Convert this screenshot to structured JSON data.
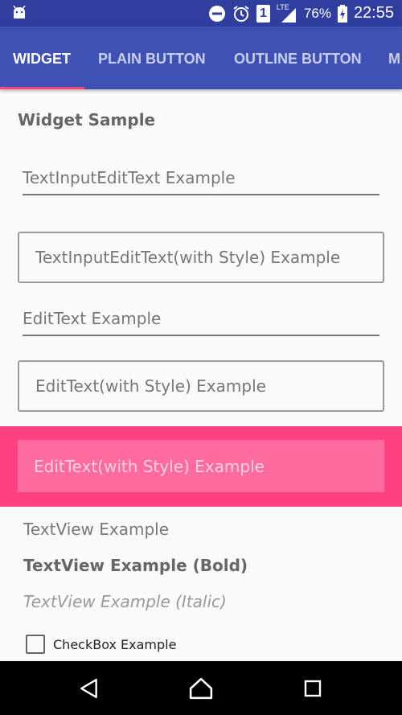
{
  "status_bar": {
    "signal_label": "LTE",
    "battery_percent": "76%",
    "time": "22:55",
    "sim_badge": "1",
    "icons": [
      "android-icon",
      "do-not-disturb-icon",
      "alarm-icon",
      "sim-icon",
      "signal-icon",
      "battery-charging-icon"
    ]
  },
  "tabs": [
    {
      "label": "WIDGET",
      "active": true
    },
    {
      "label": "PLAIN BUTTON",
      "active": false
    },
    {
      "label": "OUTLINE BUTTON",
      "active": false
    },
    {
      "label": "M",
      "active": false
    }
  ],
  "colors": {
    "primary": "#3f51b5",
    "primary_dark": "#303f9f",
    "accent": "#ff4081"
  },
  "main": {
    "section_title": "Widget Sample",
    "text_input_edit_text_placeholder": "TextInputEditText Example",
    "text_input_edit_text_styled_placeholder": "TextInputEditText(with Style) Example",
    "edit_text_placeholder": "EditText Example",
    "edit_text_styled_placeholder": "EditText(with Style) Example",
    "edit_text_accent_placeholder": "EditText(with Style) Example",
    "text_view": "TextView Example",
    "text_view_bold": "TextView Example (Bold)",
    "text_view_italic": "TextView Example (Italic)",
    "checkbox_label": "CheckBox Example",
    "checkbox_checked": false
  },
  "nav_bar": {
    "icons": [
      "back-icon",
      "home-icon",
      "recents-icon"
    ]
  }
}
